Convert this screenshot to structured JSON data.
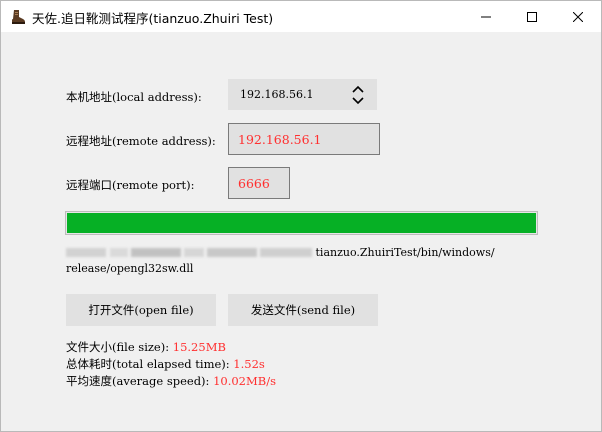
{
  "window": {
    "title": "天佐.追日靴测试程序(tianzuo.Zhuiri Test)",
    "icon": "boot-icon",
    "buttons": [
      "minimize-icon",
      "maximize-icon",
      "close-icon"
    ]
  },
  "form": {
    "local_address_label": "本机地址(local address):",
    "local_address_value": "192.168.56.1",
    "remote_address_label": "远程地址(remote address):",
    "remote_address_value": "192.168.56.1",
    "remote_port_label": "远程端口(remote port):",
    "remote_port_value": "6666"
  },
  "progress": {
    "value_percent": 100,
    "color": "#06b025"
  },
  "file_path": {
    "line1_visible": "tianzuo.ZhuiriTest/bin/windows/",
    "line2": "release/opengl32sw.dll"
  },
  "buttons": {
    "open_file": "打开文件(open file)",
    "send_file": "发送文件(send file)"
  },
  "stats": {
    "file_size_label": "文件大小(file size):",
    "file_size_value": "15.25MB",
    "elapsed_label": "总体耗时(total elapsed time):",
    "elapsed_value": "1.52s",
    "speed_label": "平均速度(average speed):",
    "speed_value": "10.02MB/s"
  },
  "colors": {
    "value_red": "#ff3030",
    "field_bg": "#e1e1e1",
    "window_bg": "#f0f0f0"
  }
}
